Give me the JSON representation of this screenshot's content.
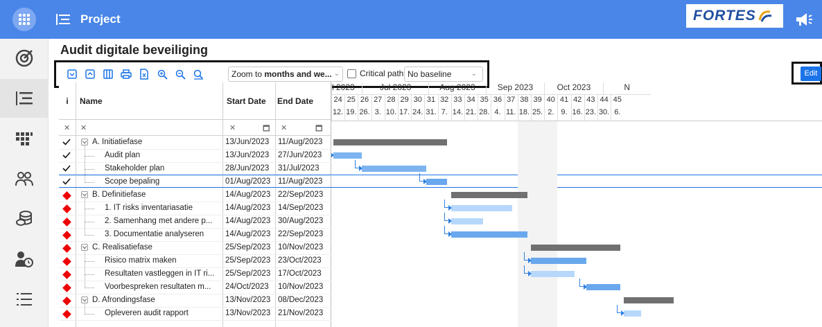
{
  "header": {
    "app_title": "Project",
    "logo_text": "FORTES",
    "accent": "#4a86e8"
  },
  "page": {
    "title": "Audit digitale beveiliging"
  },
  "toolbar": {
    "zoom_prefix": "Zoom to ",
    "zoom_bold": "months and we...",
    "critical_path_label": "Critical path",
    "baseline_value": "No baseline",
    "edit_label": "Edit"
  },
  "table": {
    "col_i": "i",
    "col_name": "Name",
    "col_start": "Start Date",
    "col_end": "End Date",
    "rows": [
      {
        "status": "check",
        "level": 0,
        "name": "A. Initiatiefase",
        "start": "13/Jun/2023",
        "end": "11/Aug/2023"
      },
      {
        "status": "check",
        "level": 1,
        "name": "Audit plan",
        "start": "13/Jun/2023",
        "end": "27/Jun/2023"
      },
      {
        "status": "check",
        "level": 1,
        "name": "Stakeholder plan",
        "start": "28/Jun/2023",
        "end": "31/Jul/2023"
      },
      {
        "status": "check",
        "level": 1,
        "name": "Scope bepaling",
        "start": "01/Aug/2023",
        "end": "11/Aug/2023"
      },
      {
        "status": "risk",
        "level": 0,
        "name": "B. Definitiefase",
        "start": "14/Aug/2023",
        "end": "22/Sep/2023"
      },
      {
        "status": "risk",
        "level": 1,
        "name": "1. IT risks inventariasatie",
        "start": "14/Aug/2023",
        "end": "14/Sep/2023"
      },
      {
        "status": "risk",
        "level": 1,
        "name": "2. Samenhang met andere p...",
        "start": "14/Aug/2023",
        "end": "30/Aug/2023"
      },
      {
        "status": "risk",
        "level": 1,
        "name": "3. Documentatie analyseren",
        "start": "14/Aug/2023",
        "end": "22/Sep/2023"
      },
      {
        "status": "risk",
        "level": 0,
        "name": "C. Realisatiefase",
        "start": "25/Sep/2023",
        "end": "10/Nov/2023"
      },
      {
        "status": "risk",
        "level": 1,
        "name": "Risico matrix maken",
        "start": "25/Sep/2023",
        "end": "23/Oct/2023"
      },
      {
        "status": "risk",
        "level": 1,
        "name": "Resultaten vastleggen in IT ri...",
        "start": "25/Sep/2023",
        "end": "17/Oct/2023"
      },
      {
        "status": "risk",
        "level": 1,
        "name": "Voorbespreken resultaten m...",
        "start": "24/Oct/2023",
        "end": "10/Nov/2023"
      },
      {
        "status": "risk",
        "level": 0,
        "name": "D. Afrondingsfase",
        "start": "13/Nov/2023",
        "end": "08/Dec/2023"
      },
      {
        "status": "risk",
        "level": 1,
        "name": "Opleveren audit rapport",
        "start": "13/Nov/2023",
        "end": "21/Nov/2023"
      }
    ]
  },
  "timeline": {
    "months": [
      "l 2023",
      "Jul 2023",
      "Aug 2023",
      "Sep 2023",
      "Oct 2023",
      "N"
    ],
    "weeks": [
      "24",
      "25",
      "26",
      "27",
      "28",
      "29",
      "30",
      "31",
      "32",
      "33",
      "34",
      "35",
      "36",
      "37",
      "38",
      "39",
      "40",
      "41",
      "42",
      "43",
      "44",
      "45"
    ],
    "days": [
      "12.",
      "19.",
      "26.",
      "3.",
      "10.",
      "17.",
      "24.",
      "31.",
      "7.",
      "14.",
      "21.",
      "28.",
      "4.",
      "11.",
      "18.",
      "25.",
      "2.",
      "9.",
      "16.",
      "23.",
      "30.",
      "6."
    ]
  }
}
